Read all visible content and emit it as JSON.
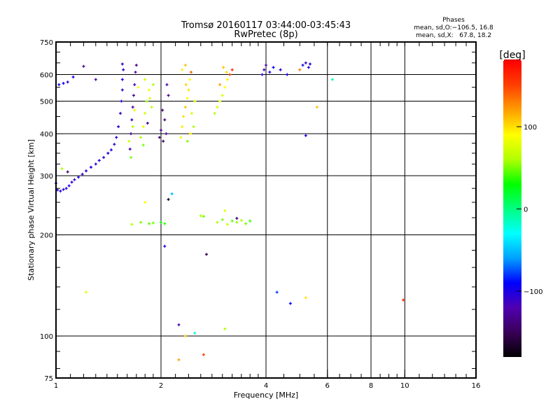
{
  "chart_data": {
    "type": "scatter",
    "title": "Tromsø 20160117 03:44:00-03:45:43",
    "subtitle": "RwPretec (8p)",
    "xlabel": "Frequency [MHz]",
    "ylabel": "Stationary phase Virtual Height [km]",
    "xscale": "log",
    "yscale": "log",
    "xlim": [
      1,
      16
    ],
    "ylim": [
      75,
      750
    ],
    "xticks": [
      1,
      2,
      4,
      6,
      8,
      10,
      16
    ],
    "xtick_labels": [
      "1",
      "2",
      "4",
      "6",
      "8",
      "10",
      "16"
    ],
    "yticks": [
      75,
      100,
      200,
      300,
      400,
      500,
      600,
      750
    ],
    "ytick_labels": [
      "75",
      "100",
      "200",
      "300",
      "400",
      "500",
      "600",
      "750"
    ],
    "xgrid": [
      2,
      4,
      6,
      8,
      10
    ],
    "ygrid": [
      100,
      200,
      300,
      400,
      500,
      600
    ],
    "grid": true,
    "stats": {
      "heading": "Phases",
      "line_o": "mean, sd,O:−106.5, 16.8",
      "line_x": "mean, sd,X:   67.8, 18.2"
    },
    "colorbar": {
      "label": "[deg]",
      "range": [
        -180,
        180
      ],
      "ticks": [
        100,
        0,
        -100
      ],
      "tick_labels": [
        "100",
        "0",
        "−100"
      ],
      "colormap": [
        "#000000",
        "#3a0058",
        "#5000b0",
        "#0000ff",
        "#00a0ff",
        "#00ffff",
        "#00ff80",
        "#00ff00",
        "#b0ff00",
        "#ffff00",
        "#ffa000",
        "#ff4000",
        "#ff0000"
      ]
    },
    "point_fields": [
      "frequency_mhz",
      "height_km",
      "phase_deg"
    ],
    "points": [
      [
        1.0,
        285,
        -110
      ],
      [
        1.01,
        272,
        -105
      ],
      [
        1.03,
        270,
        -100
      ],
      [
        1.05,
        273,
        -110
      ],
      [
        1.07,
        275,
        -105
      ],
      [
        1.09,
        280,
        -100
      ],
      [
        1.11,
        287,
        -110
      ],
      [
        1.13,
        292,
        -105
      ],
      [
        1.16,
        297,
        -100
      ],
      [
        1.19,
        303,
        -110
      ],
      [
        1.22,
        310,
        -105
      ],
      [
        1.26,
        318,
        -100
      ],
      [
        1.3,
        325,
        -110
      ],
      [
        1.33,
        333,
        -105
      ],
      [
        1.37,
        340,
        -110
      ],
      [
        1.41,
        350,
        -100
      ],
      [
        1.44,
        358,
        -105
      ],
      [
        1.47,
        372,
        -110
      ],
      [
        1.49,
        390,
        -105
      ],
      [
        1.51,
        420,
        -100
      ],
      [
        1.53,
        460,
        -110
      ],
      [
        1.54,
        500,
        -105
      ],
      [
        1.55,
        540,
        -110
      ],
      [
        1.55,
        580,
        -100
      ],
      [
        1.56,
        620,
        -105
      ],
      [
        1.55,
        645,
        -110
      ],
      [
        1.02,
        560,
        -100
      ],
      [
        1.05,
        565,
        -95
      ],
      [
        1.08,
        570,
        -110
      ],
      [
        1.12,
        590,
        -100
      ],
      [
        1.2,
        635,
        -130
      ],
      [
        1.3,
        580,
        -120
      ],
      [
        1.04,
        315,
        60
      ],
      [
        1.08,
        308,
        -140
      ],
      [
        1.63,
        360,
        -120
      ],
      [
        1.64,
        400,
        -130
      ],
      [
        1.65,
        440,
        -110
      ],
      [
        1.66,
        480,
        -125
      ],
      [
        1.67,
        520,
        -130
      ],
      [
        1.68,
        560,
        -115
      ],
      [
        1.69,
        610,
        -120
      ],
      [
        1.7,
        640,
        -135
      ],
      [
        1.62,
        380,
        70
      ],
      [
        1.66,
        420,
        60
      ],
      [
        1.68,
        470,
        80
      ],
      [
        1.64,
        340,
        50
      ],
      [
        1.75,
        390,
        60
      ],
      [
        1.78,
        420,
        80
      ],
      [
        1.8,
        460,
        70
      ],
      [
        1.82,
        500,
        55
      ],
      [
        1.85,
        540,
        85
      ],
      [
        1.88,
        480,
        65
      ],
      [
        1.78,
        370,
        50
      ],
      [
        1.83,
        430,
        -130
      ],
      [
        1.86,
        510,
        75
      ],
      [
        1.9,
        560,
        60
      ],
      [
        1.72,
        550,
        90
      ],
      [
        1.8,
        580,
        70
      ],
      [
        1.98,
        390,
        -140
      ],
      [
        2.0,
        410,
        -130
      ],
      [
        2.03,
        380,
        -145
      ],
      [
        2.05,
        440,
        -135
      ],
      [
        2.07,
        400,
        -125
      ],
      [
        2.02,
        470,
        -140
      ],
      [
        2.1,
        520,
        -130
      ],
      [
        2.08,
        560,
        -120
      ],
      [
        2.28,
        390,
        80
      ],
      [
        2.3,
        420,
        95
      ],
      [
        2.32,
        450,
        100
      ],
      [
        2.35,
        480,
        110
      ],
      [
        2.38,
        510,
        90
      ],
      [
        2.4,
        540,
        100
      ],
      [
        2.42,
        580,
        85
      ],
      [
        2.3,
        620,
        95
      ],
      [
        2.35,
        640,
        110
      ],
      [
        2.45,
        460,
        75
      ],
      [
        2.48,
        420,
        60
      ],
      [
        2.43,
        400,
        100
      ],
      [
        2.38,
        380,
        50
      ],
      [
        2.5,
        500,
        70
      ],
      [
        2.44,
        610,
        140
      ],
      [
        2.36,
        560,
        105
      ],
      [
        2.85,
        460,
        60
      ],
      [
        2.9,
        480,
        70
      ],
      [
        2.95,
        500,
        80
      ],
      [
        3.0,
        520,
        75
      ],
      [
        3.05,
        550,
        90
      ],
      [
        3.1,
        580,
        95
      ],
      [
        3.08,
        610,
        100
      ],
      [
        3.02,
        630,
        110
      ],
      [
        2.95,
        560,
        120
      ],
      [
        3.15,
        600,
        150
      ],
      [
        3.2,
        620,
        160
      ],
      [
        3.9,
        600,
        -100
      ],
      [
        3.95,
        620,
        -110
      ],
      [
        4.0,
        640,
        -120
      ],
      [
        4.1,
        610,
        -100
      ],
      [
        4.2,
        630,
        -90
      ],
      [
        4.4,
        620,
        -100
      ],
      [
        4.6,
        600,
        -95
      ],
      [
        5.0,
        620,
        130
      ],
      [
        5.1,
        640,
        -100
      ],
      [
        5.2,
        650,
        -110
      ],
      [
        5.3,
        630,
        -105
      ],
      [
        5.35,
        645,
        -95
      ],
      [
        5.6,
        480,
        110
      ],
      [
        6.2,
        580,
        -10
      ],
      [
        1.65,
        215,
        60
      ],
      [
        1.75,
        218,
        50
      ],
      [
        1.85,
        216,
        45
      ],
      [
        1.9,
        217,
        50
      ],
      [
        2.0,
        218,
        30
      ],
      [
        2.05,
        216,
        40
      ],
      [
        2.6,
        228,
        60
      ],
      [
        2.65,
        227,
        50
      ],
      [
        2.9,
        218,
        60
      ],
      [
        3.0,
        222,
        50
      ],
      [
        3.1,
        215,
        70
      ],
      [
        3.2,
        220,
        45
      ],
      [
        3.3,
        218,
        55
      ],
      [
        3.4,
        221,
        60
      ],
      [
        3.5,
        216,
        50
      ],
      [
        3.6,
        220,
        40
      ],
      [
        3.05,
        236,
        80
      ],
      [
        3.3,
        224,
        -140
      ],
      [
        1.8,
        250,
        90
      ],
      [
        2.15,
        265,
        -50
      ],
      [
        2.1,
        255,
        -170
      ],
      [
        2.05,
        185,
        -100
      ],
      [
        2.7,
        175,
        -150
      ],
      [
        1.22,
        135,
        80
      ],
      [
        4.3,
        135,
        -80
      ],
      [
        4.7,
        125,
        -90
      ],
      [
        5.2,
        130,
        100
      ],
      [
        9.9,
        128,
        160
      ],
      [
        2.25,
        108,
        -120
      ],
      [
        2.5,
        102,
        -20
      ],
      [
        2.35,
        100,
        110
      ],
      [
        2.25,
        85,
        120
      ],
      [
        2.65,
        88,
        150
      ],
      [
        3.05,
        105,
        60
      ],
      [
        5.2,
        395,
        -100
      ]
    ]
  }
}
